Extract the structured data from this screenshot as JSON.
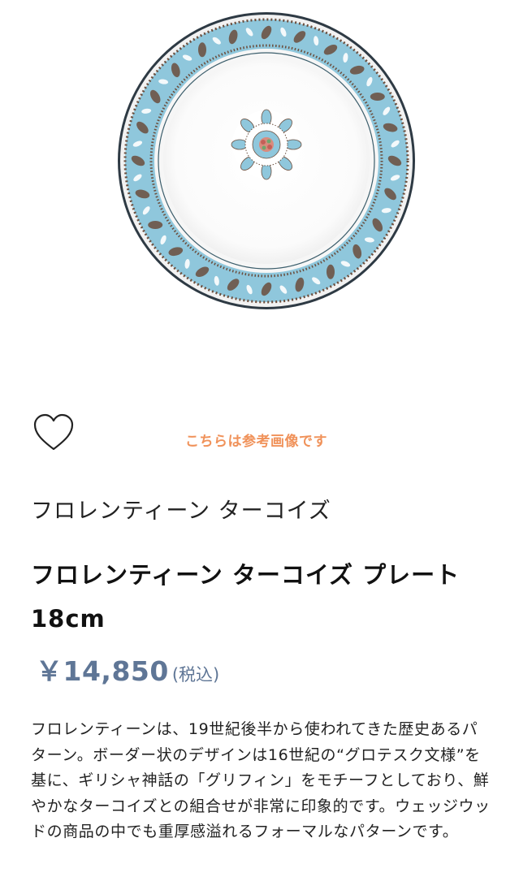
{
  "product": {
    "image_alt": "plate-image",
    "reference_note": "こちらは参考画像です",
    "collection": "フロレンティーン ターコイズ",
    "title": "フロレンティーン ターコイズ プレート 18cm",
    "price": "￥14,850",
    "tax_label": "(税込)",
    "description": "フロレンティーンは、19世紀後半から使われてきた歴史あるパターン。ボーダー状のデザインは16世紀の“グロテスク文様”を基に、ギリシャ神話の「グリフィン」をモチーフとしており、鮮やかなターコイズとの組合せが非常に印象的です。ウェッジウッドの商品の中でも重厚感溢れるフォーマルなパターンです。"
  },
  "icons": {
    "favorite": "heart-outline-icon"
  },
  "colors": {
    "accent_note": "#f0925a",
    "price": "#5f7696",
    "plate_turquoise": "#8fc7dc",
    "plate_brown": "#6b4e3d"
  }
}
